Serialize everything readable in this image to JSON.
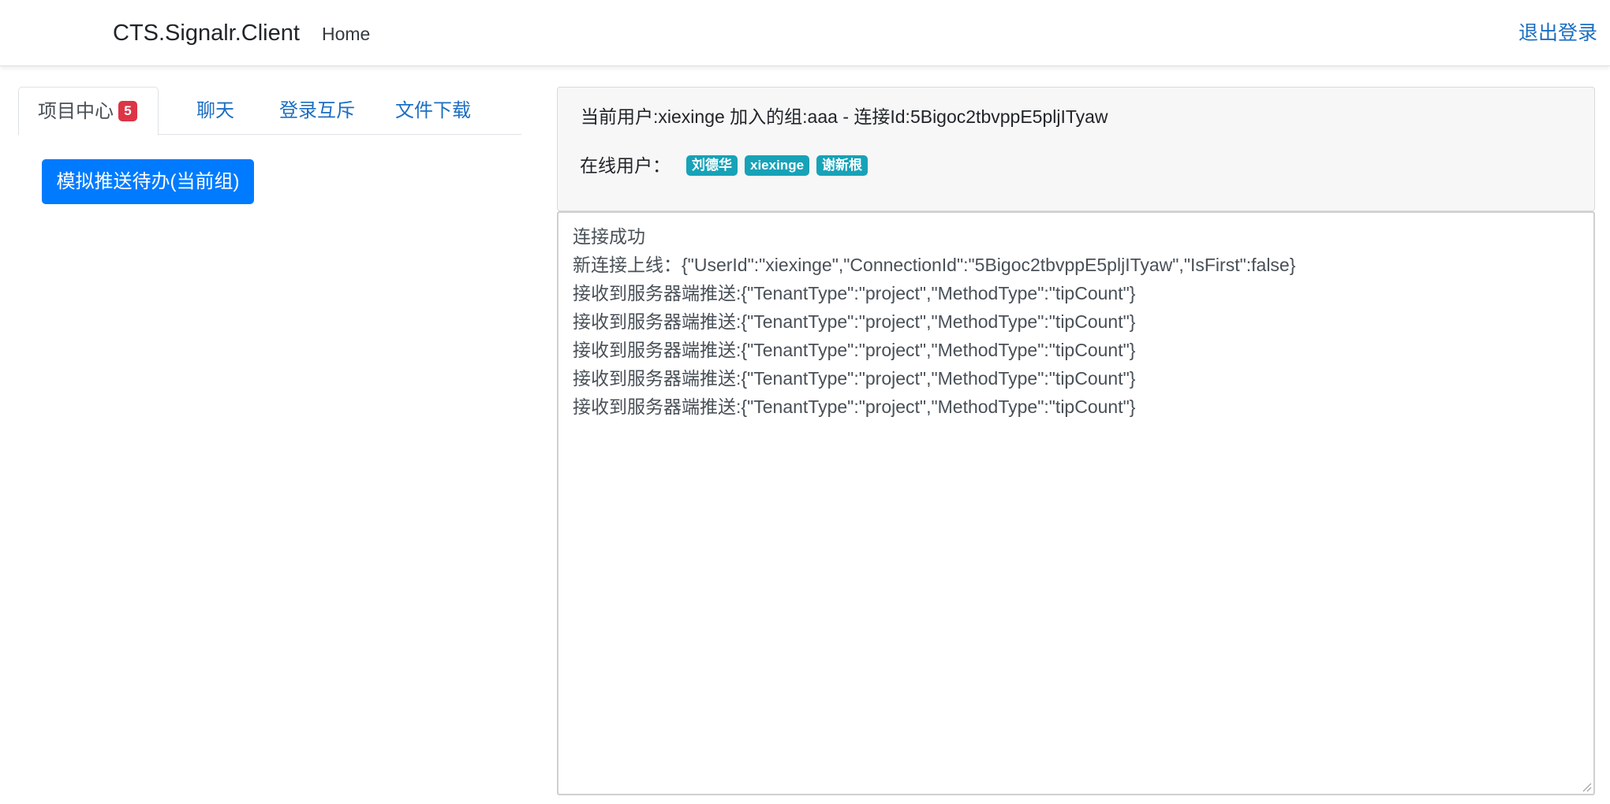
{
  "navbar": {
    "brand": "CTS.Signalr.Client",
    "home_label": "Home",
    "logout_label": "退出登录"
  },
  "tabs": [
    {
      "label": "项目中心",
      "badge": "5",
      "active": true
    },
    {
      "label": "聊天"
    },
    {
      "label": "登录互斥"
    },
    {
      "label": "文件下载"
    }
  ],
  "simulate_button_label": "模拟推送待办(当前组)",
  "info": {
    "current_user_line": "当前用户:xiexinge 加入的组:aaa - 连接Id:5Bigoc2tbvppE5pljITyaw",
    "online_label": "在线用户：",
    "online_users": [
      "刘德华",
      "xiexinge",
      "谢新根"
    ]
  },
  "log_lines": [
    "连接成功",
    "新连接上线：{\"UserId\":\"xiexinge\",\"ConnectionId\":\"5Bigoc2tbvppE5pljITyaw\",\"IsFirst\":false}",
    "接收到服务器端推送:{\"TenantType\":\"project\",\"MethodType\":\"tipCount\"}",
    "接收到服务器端推送:{\"TenantType\":\"project\",\"MethodType\":\"tipCount\"}",
    "接收到服务器端推送:{\"TenantType\":\"project\",\"MethodType\":\"tipCount\"}",
    "接收到服务器端推送:{\"TenantType\":\"project\",\"MethodType\":\"tipCount\"}",
    "接收到服务器端推送:{\"TenantType\":\"project\",\"MethodType\":\"tipCount\"}"
  ],
  "colors": {
    "link": "#1b6ec2",
    "primary": "#007bff",
    "danger_badge": "#dc3545",
    "info_badge": "#17a2b8"
  }
}
